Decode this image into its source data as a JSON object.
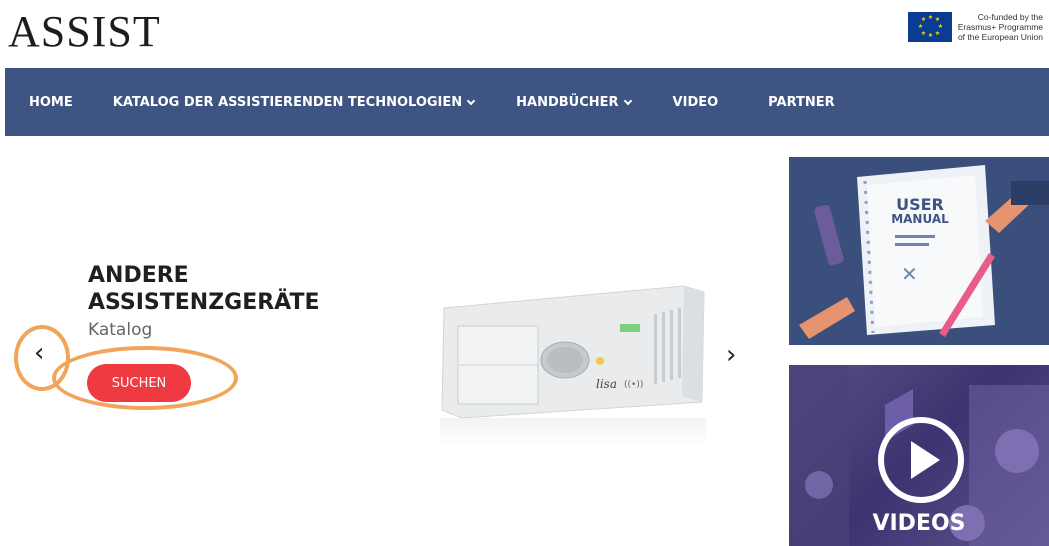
{
  "header": {
    "logo": "ASSIST",
    "eu_line1": "Co-funded by the",
    "eu_line2": "Erasmus+ Programme",
    "eu_line3": "of the European Union"
  },
  "nav": {
    "items": [
      {
        "label": "HOME",
        "has_dropdown": false
      },
      {
        "label": "KATALOG DER ASSISTIERENDEN TECHNOLOGIEN",
        "has_dropdown": true
      },
      {
        "label": "HANDBÜCHER",
        "has_dropdown": true
      },
      {
        "label": "VIDEO",
        "has_dropdown": false
      },
      {
        "label": "PARTNER",
        "has_dropdown": false
      }
    ]
  },
  "slider": {
    "title_line1": "ANDERE",
    "title_line2": "ASSISTENZGERÄTE",
    "subtitle": "Katalog",
    "button_label": "SUCHEN",
    "prev_arrow": "‹",
    "next_arrow": "›",
    "device_brand": "lisa"
  },
  "cards": {
    "manual_line1": "USER",
    "manual_line2": "MANUAL",
    "videos_label": "VIDEOS"
  },
  "colors": {
    "nav_bg": "#3e5583",
    "button_bg": "#ee3a40",
    "highlight": "#f0a55a",
    "manual_card_bg": "#3a4f7c"
  }
}
